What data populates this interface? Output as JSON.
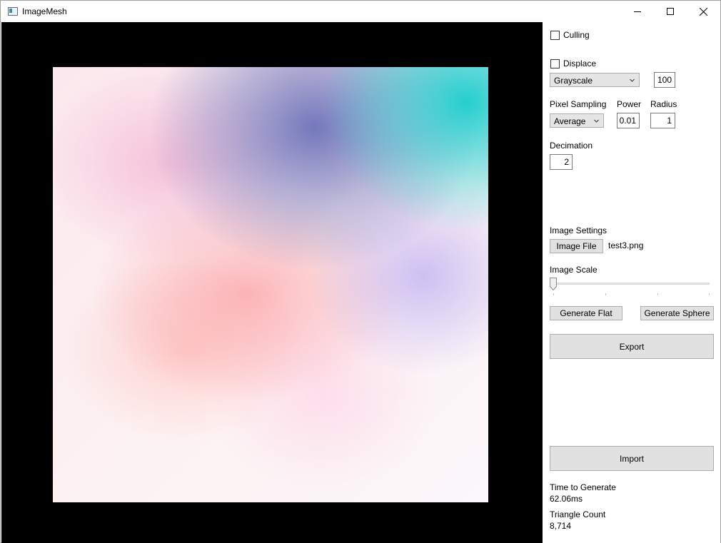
{
  "window": {
    "title": "ImageMesh"
  },
  "controls": {
    "culling_label": "Culling",
    "displace_label": "Displace",
    "displace_mode": "Grayscale",
    "displace_amount": "100",
    "pixel_sampling_label": "Pixel Sampling",
    "pixel_sampling_value": "Average",
    "power_label": "Power",
    "power_value": "0.01",
    "radius_label": "Radius",
    "radius_value": "1",
    "decimation_label": "Decimation",
    "decimation_value": "2"
  },
  "image_settings": {
    "heading": "Image Settings",
    "image_file_button": "Image File",
    "file_name": "test3.png",
    "scale_label": "Image Scale",
    "scale_value": 0
  },
  "actions": {
    "generate_flat": "Generate Flat",
    "generate_sphere": "Generate Sphere",
    "export": "Export",
    "import": "Import"
  },
  "stats": {
    "time_label": "Time to Generate",
    "time_value": "62.06ms",
    "triangles_label": "Triangle Count",
    "triangles_value": "8,714"
  }
}
